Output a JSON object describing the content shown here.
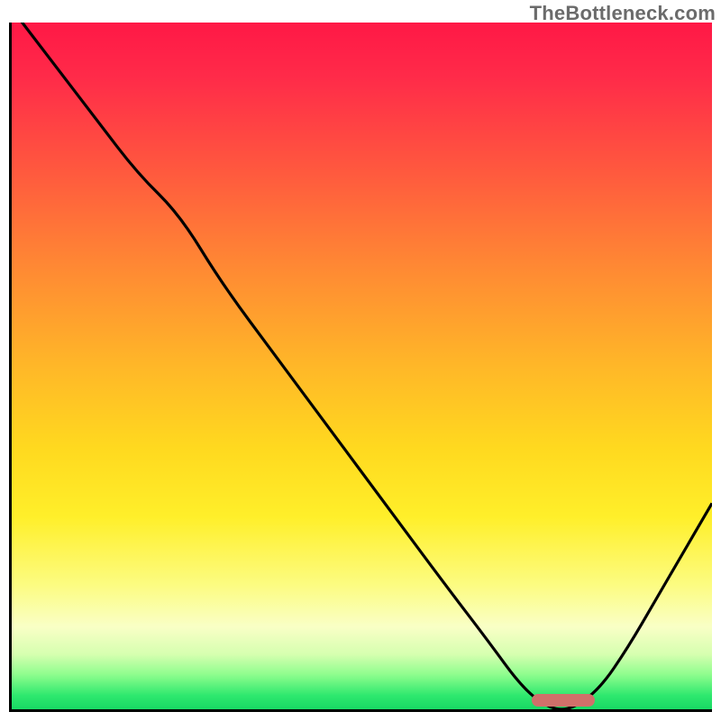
{
  "watermark": "TheBottleneck.com",
  "colors": {
    "top": "#ff1846",
    "mid": "#ffd91f",
    "bottom": "#18d964",
    "marker": "#d0706a",
    "axis": "#000000"
  },
  "chart_data": {
    "type": "line",
    "title": "",
    "xlabel": "",
    "ylabel": "",
    "xlim": [
      0,
      100
    ],
    "ylim": [
      0,
      100
    ],
    "grid": false,
    "series": [
      {
        "name": "bottleneck-curve",
        "x": [
          0,
          6,
          12,
          18,
          24,
          30,
          38,
          46,
          54,
          62,
          68,
          73,
          77,
          80,
          84,
          88,
          92,
          96,
          100
        ],
        "values": [
          102,
          94,
          86,
          78,
          72,
          62,
          51,
          40,
          29,
          18,
          10,
          3,
          0,
          0,
          3,
          9,
          16,
          23,
          30
        ]
      }
    ],
    "optimal_range_x": [
      74,
      83
    ],
    "optimal_range_y": 0,
    "background_bands_pct": {
      "red_orange_yellow_end": 82,
      "pale_yellow_end": 88,
      "greens_start": 92
    }
  }
}
